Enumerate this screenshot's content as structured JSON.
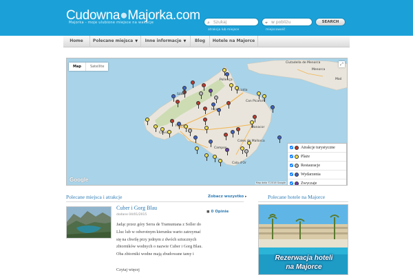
{
  "header": {
    "logo_part1": "Cudowna",
    "logo_part2": "Majorka",
    "logo_part3": ".com",
    "tagline": "Majorka - moje ulubione miejsce na wakacje",
    "search_placeholder": "Szukaj",
    "search_hint": "atrakcja lub miejsce",
    "near_placeholder": "w pobliżu",
    "near_hint": "miejscowość",
    "search_button": "SEARCH"
  },
  "nav": {
    "items": [
      {
        "label": "Home",
        "dropdown": false
      },
      {
        "label": "Polecane miejsca",
        "dropdown": true
      },
      {
        "label": "Inne informacje",
        "dropdown": true
      },
      {
        "label": "Blog",
        "dropdown": false
      },
      {
        "label": "Hotele na Majorce",
        "dropdown": false
      }
    ]
  },
  "map": {
    "type_map": "Map",
    "type_satellite": "Satellite",
    "brand": "Google",
    "attribution": "Map data ©2016 Google",
    "labels": {
      "ciutadella": "Ciutadella de Menorca",
      "menorca": "Menorca",
      "mao": "Maó",
      "pollenca": "Pollença",
      "alcudia": "Alcúdia",
      "can_picafort": "Can Picafort",
      "soller": "Sóller",
      "inca": "Inca",
      "manacor": "Manacor",
      "palma": "Palma",
      "calvia": "Calvià",
      "campos": "Campos",
      "cales": "Cales de Mallorca",
      "cala_dor": "Cala d'Or"
    },
    "legend": [
      {
        "label": "Atrakcje turystyczne",
        "color": "#c0392b"
      },
      {
        "label": "Plaże",
        "color": "#f0e04a"
      },
      {
        "label": "Restauracje",
        "color": "#b9b9b9"
      },
      {
        "label": "Wydarzenia",
        "color": "#3f63c7"
      },
      {
        "label": "Zwyczaje",
        "color": "#6a3fb3"
      }
    ]
  },
  "places": {
    "section_title": "Polecane miejsca i atrakcje",
    "see_all": "Zobacz wszystko",
    "article": {
      "title": "Cuber i Gorg Blau",
      "date": "dodane 04/01/2015",
      "comments_count": "0",
      "comments_label": "Opinie",
      "body": "Jadąc przez góry Serra de Tramuntana z Soller do Lluc lub w odwrotnym kierunku warto zatrzymać się na chwilę przy jednym z dwóch sztucznych zbiorników wodnych o nazwie Cuber i Gorg Blau. Oba zbiorniki wodne mają zbudowane tamy i",
      "read_more": "Czytaj więcej"
    }
  },
  "hotels": {
    "section_title": "Polecane hotele na Majorce",
    "banner_line1": "Rezerwacja hoteli",
    "banner_line2": "na Majorce"
  }
}
